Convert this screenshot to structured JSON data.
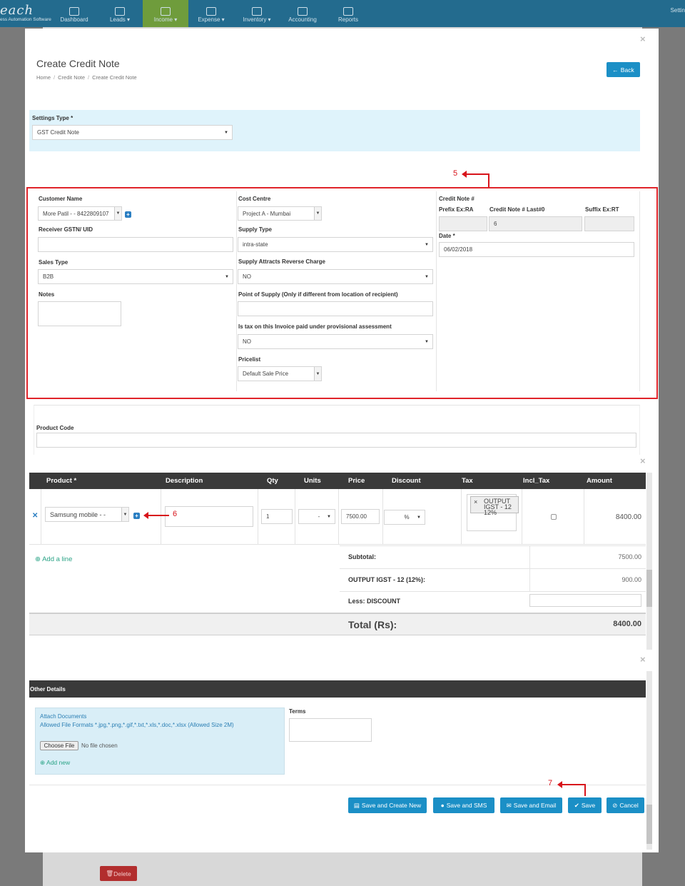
{
  "nav": {
    "logo_text": "each",
    "logo_sub": "ess Automation Software",
    "items": [
      {
        "label": "Dashboard"
      },
      {
        "label": "Leads ▾"
      },
      {
        "label": "Income ▾"
      },
      {
        "label": "Expense ▾"
      },
      {
        "label": "Inventory ▾"
      },
      {
        "label": "Accounting"
      },
      {
        "label": "Reports"
      }
    ],
    "right_label": "Settin"
  },
  "page": {
    "title": "Create Credit Note",
    "breadcrumb": [
      "Home",
      "Credit Note",
      "Create Credit Note"
    ],
    "back_label": "Back"
  },
  "settings": {
    "label": "Settings Type *",
    "value": "GST Credit Note"
  },
  "form": {
    "customer_name_label": "Customer Name",
    "customer_name_value": "More Patil - - 8422809107",
    "receiver_gstn_label": "Receiver GSTN/ UID",
    "sales_type_label": "Sales Type",
    "sales_type_value": "B2B",
    "notes_label": "Notes",
    "cost_centre_label": "Cost Centre",
    "cost_centre_value": "Project A - Mumbai",
    "supply_type_label": "Supply Type",
    "supply_type_value": "intra-state",
    "reverse_charge_label": "Supply Attracts Reverse Charge",
    "reverse_charge_value": "NO",
    "point_of_supply_label": "Point of Supply (Only if different from location of recipient)",
    "provisional_label": "Is tax on this Invoice paid under provisional assessment",
    "provisional_value": "NO",
    "pricelist_label": "Pricelist",
    "pricelist_value": "Default Sale Price",
    "credit_note_label": "Credit Note #",
    "prefix_label": "Prefix Ex:RA",
    "last_label": "Credit Note # Last#0",
    "last_value": "6",
    "suffix_label": "Suffix Ex:RT",
    "date_label": "Date *",
    "date_value": "06/02/2018"
  },
  "product_code_label": "Product Code",
  "table": {
    "headers": [
      "Product *",
      "Description",
      "Qty",
      "Units",
      "Price",
      "Discount",
      "Tax",
      "Incl_Tax",
      "Amount"
    ],
    "row": {
      "product": "Samsung mobile - -",
      "qty": "1",
      "units": "-",
      "price": "7500.00",
      "discount_unit": "%",
      "tax_tag": "OUTPUT IGST - 12 12%",
      "amount": "8400.00"
    },
    "add_line": "Add a line",
    "subtotal_label": "Subtotal:",
    "subtotal_value": "7500.00",
    "igst_label": "OUTPUT IGST - 12 (12%):",
    "igst_value": "900.00",
    "discount_label": "Less: DISCOUNT",
    "total_label": "Total (Rs):",
    "total_value": "8400.00"
  },
  "other": {
    "header": "Other Details",
    "attach_title": "Attach Documents",
    "attach_formats": "Allowed File Formats *.jpg,*.png,*.gif,*.txt,*.xls,*.doc,*.xlsx (Allowed Size 2M)",
    "choose_file": "Choose File",
    "no_file": "No file chosen",
    "add_new": "Add new",
    "terms_label": "Terms"
  },
  "buttons": {
    "save_create_new": "Save and Create New",
    "save_sms": "Save and SMS",
    "save_email": "Save and Email",
    "save": "Save",
    "cancel": "Cancel",
    "delete": "Delete"
  },
  "annotations": {
    "a5": "5",
    "a6": "6",
    "a7": "7"
  },
  "colors": {
    "nav_bg": "#236b8e",
    "nav_active": "#6f9c3c",
    "primary": "#1b8fc6",
    "annotation": "#d8141b",
    "table_header": "#3a3a3a"
  }
}
